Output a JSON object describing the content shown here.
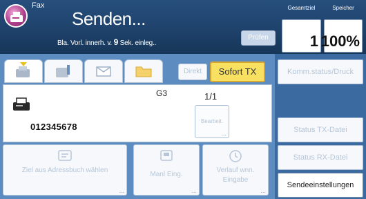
{
  "app": {
    "name": "Fax",
    "icon": "fax-app-icon"
  },
  "header": {
    "title": "Senden...",
    "subtitle_before": "Bla. Vorl. innerh. v.",
    "subtitle_seconds": "9",
    "subtitle_after": "Sek. einleg..",
    "pruefen_label": "Prüfen"
  },
  "counters": {
    "total_label": "Gesamtziel",
    "total_value": "1",
    "memory_label": "Speicher",
    "memory_value": "100%"
  },
  "tabs": {
    "icons": [
      "fax-destination-icon",
      "info-address-icon",
      "email-icon",
      "folder-icon"
    ],
    "direkt_label": "Direkt",
    "sofort_label": "Sofort TX"
  },
  "destination": {
    "mode": "G3",
    "count": "1/1",
    "number": "012345678",
    "edit_label": "Bearbeit."
  },
  "bottom_buttons": {
    "address_book_label": "Ziel aus Adressbuch wählen",
    "manual_entry_label": "Manl Eing.",
    "history_label": "Verlauf wnn. Eingabe"
  },
  "right_buttons": {
    "comm_status": "Komm.status/Druck",
    "status_tx": "Status TX-Datei",
    "status_rx": "Status RX-Datei",
    "send_settings": "Sendeeinstellungen"
  },
  "colors": {
    "accent_yellow": "#f8e060",
    "panel_blue": "#5d8cc0"
  }
}
